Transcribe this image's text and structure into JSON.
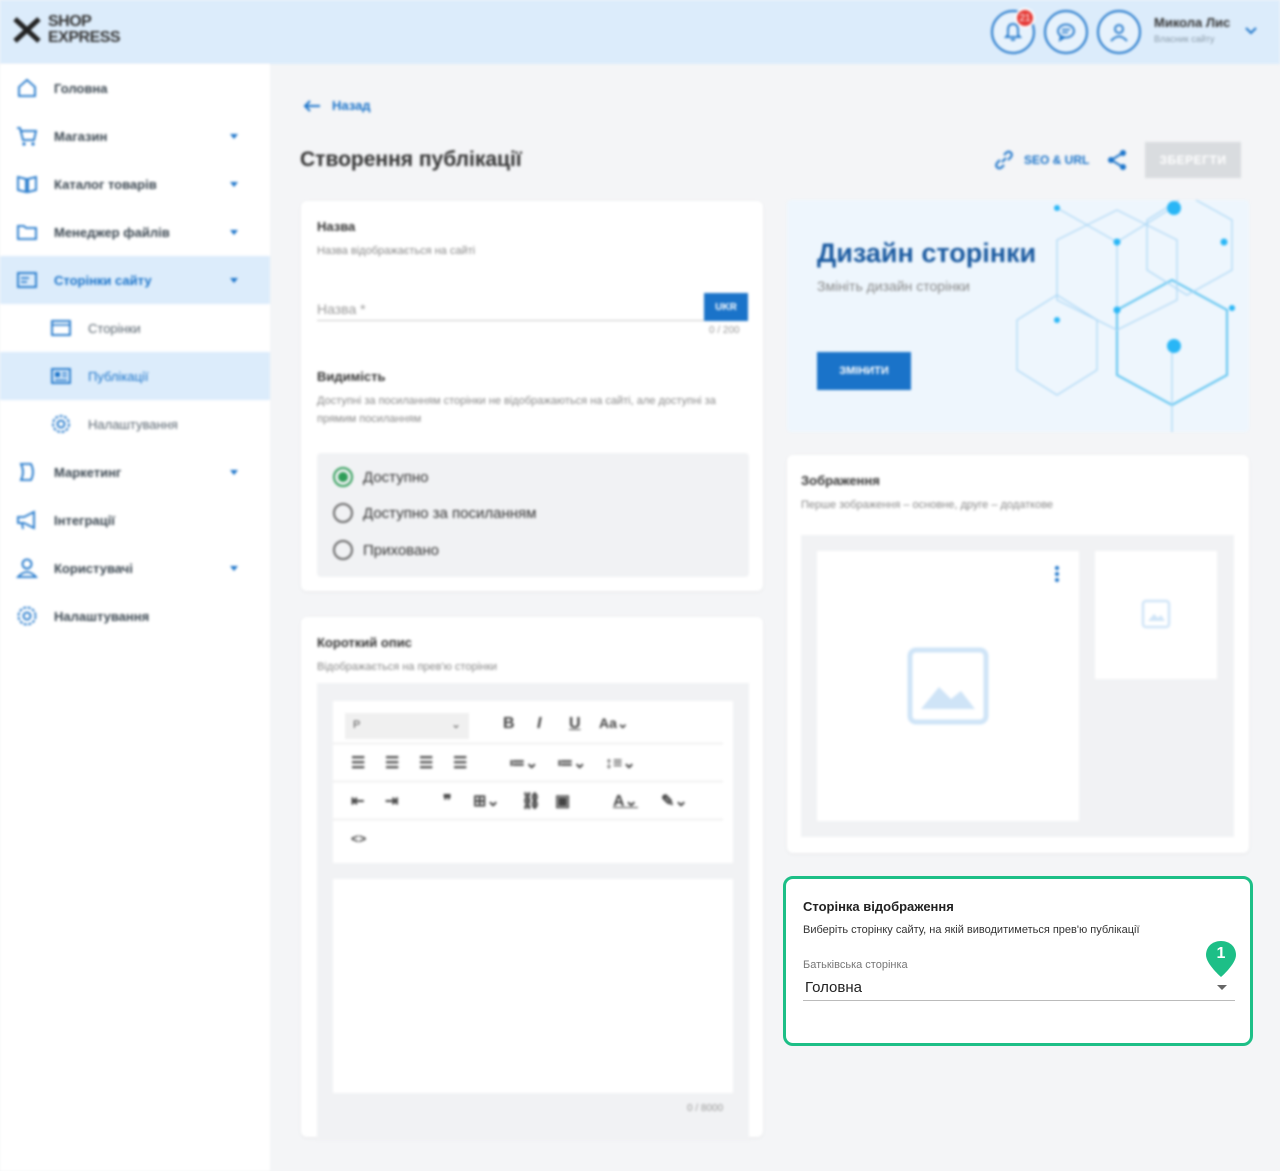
{
  "header": {
    "logo_line1": "SHOP",
    "logo_line2": "EXPRESS",
    "notification_count": "21",
    "user_name": "Микола Лис",
    "user_role": "Власник сайту"
  },
  "sidebar": {
    "items": [
      {
        "label": "Головна",
        "icon": "home-icon"
      },
      {
        "label": "Магазин",
        "icon": "cart-icon"
      },
      {
        "label": "Каталог товарів",
        "icon": "catalog-icon"
      },
      {
        "label": "Менеджер файлів",
        "icon": "folder-icon"
      },
      {
        "label": "Сторінки сайту",
        "icon": "pages-icon"
      },
      {
        "label": "Сторінки",
        "icon": "page-icon"
      },
      {
        "label": "Публікації",
        "icon": "publication-icon"
      },
      {
        "label": "Налаштування",
        "icon": "gear-icon"
      },
      {
        "label": "Маркетинг",
        "icon": "marketing-icon"
      },
      {
        "label": "Інтеграції",
        "icon": "megaphone-icon"
      },
      {
        "label": "Користувачі",
        "icon": "user-icon"
      },
      {
        "label": "Налаштування",
        "icon": "gear-icon"
      }
    ]
  },
  "main": {
    "back_label": "Назад",
    "title": "Створення публікації",
    "seo_label": "SEO & URL",
    "save_label": "ЗБЕРЕГТИ"
  },
  "name_card": {
    "title": "Назва",
    "subtitle": "Назва відображається на сайті",
    "input_placeholder": "Назва *",
    "lang_button": "UKR",
    "counter": "0 / 200",
    "visibility_title": "Видимість",
    "visibility_sub": "Доступні за посиланням сторінки не відображаються на сайті, але доступні за прямим посиланням",
    "options": [
      "Доступно",
      "Доступно за посиланням",
      "Приховано"
    ],
    "selected": "Доступно"
  },
  "description_card": {
    "title": "Короткий опис",
    "subtitle": "Відображається на прев'ю сторінки",
    "paragraph_select": "P",
    "counter": "0 / 8000"
  },
  "design_card": {
    "title": "Дизайн сторінки",
    "subtitle": "Змініть дизайн сторінки",
    "button": "ЗМІНИТИ"
  },
  "images_card": {
    "title": "Зображення",
    "subtitle": "Перше зображення – основне, друге – додаткове"
  },
  "display_page_card": {
    "title": "Сторінка відображення",
    "subtitle": "Виберіть сторінку сайту, на якій виводитиметься прев'ю публікації",
    "field_label": "Батьківська сторінка",
    "field_value": "Головна",
    "marker": "1"
  },
  "colors": {
    "accent": "#1a73c9",
    "highlight": "#1dbf87",
    "radio_checked": "#2e9d57"
  }
}
